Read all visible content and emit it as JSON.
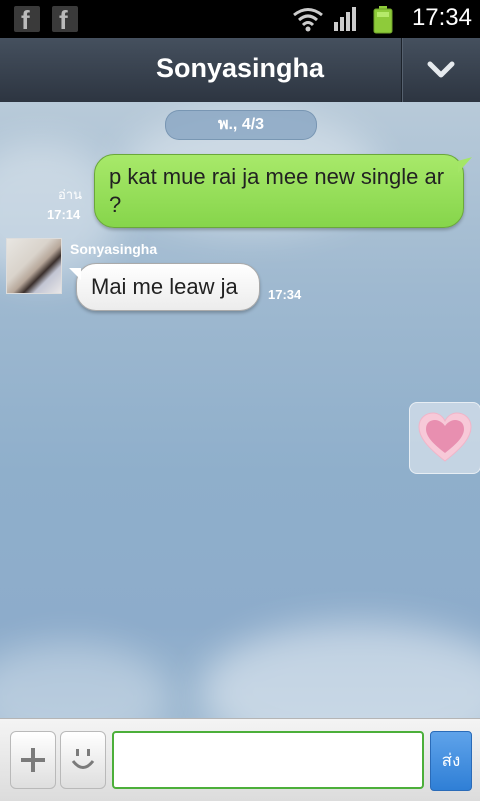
{
  "status_bar": {
    "time": "17:34",
    "notifications": [
      "facebook-icon",
      "facebook-icon"
    ],
    "icons": [
      "wifi-icon",
      "signal-icon",
      "battery-icon"
    ]
  },
  "header": {
    "title": "Sonyasingha",
    "menu_icon": "chevron-down-icon"
  },
  "chat": {
    "date": "พ., 4/3",
    "messages": [
      {
        "direction": "outgoing",
        "text": "p kat mue rai ja mee new single ar ?",
        "read_label": "อ่าน",
        "time": "17:14"
      },
      {
        "direction": "incoming",
        "sender": "Sonyasingha",
        "text": "Mai me leaw ja",
        "time": "17:34"
      }
    ],
    "sticker_button_icon": "heart-icon"
  },
  "input_bar": {
    "add_icon": "plus-icon",
    "emoji_icon": "smiley-icon",
    "message_value": "",
    "send_label": "ส่ง"
  },
  "colors": {
    "outgoing_bubble": "#94de58",
    "incoming_bubble": "#ffffff",
    "header": "#36404c",
    "send_button": "#3b87d9",
    "input_border": "#4caf3a"
  }
}
